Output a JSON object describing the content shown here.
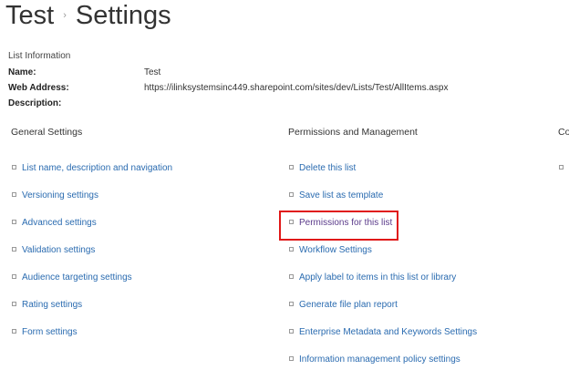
{
  "breadcrumb": {
    "list": "Test",
    "separator": "›",
    "page": "Settings"
  },
  "list_info": {
    "heading": "List Information",
    "name_label": "Name:",
    "name_value": "Test",
    "web_label": "Web Address:",
    "web_value": "https://ilinksystemsinc449.sharepoint.com/sites/dev/Lists/Test/AllItems.aspx",
    "desc_label": "Description:"
  },
  "sections": [
    {
      "title": "General Settings",
      "items": [
        "List name, description and navigation",
        "Versioning settings",
        "Advanced settings",
        "Validation settings",
        "Audience targeting settings",
        "Rating settings",
        "Form settings"
      ]
    },
    {
      "title": "Permissions and Management",
      "items": [
        "Delete this list",
        "Save list as template",
        "Permissions for this list",
        "Workflow Settings",
        "Apply label to items in this list or library",
        "Generate file plan report",
        "Enterprise Metadata and Keywords Settings",
        "Information management policy settings"
      ]
    },
    {
      "title": "Co",
      "items": [
        ""
      ]
    }
  ],
  "highlight_color": "#e01818"
}
